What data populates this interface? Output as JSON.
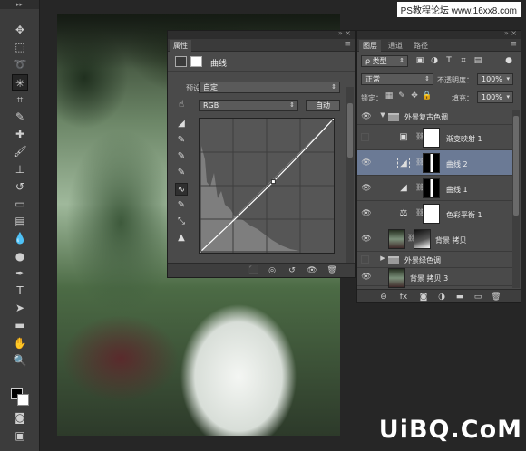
{
  "watermark_top": "PS教程论坛 www.16xx8.com",
  "watermark_bottom": "UiBQ.CoM",
  "toolbar": {
    "tools": [
      {
        "name": "move-tool",
        "glyph": "✥"
      },
      {
        "name": "marquee-tool",
        "glyph": "⬚"
      },
      {
        "name": "lasso-tool",
        "glyph": "➰"
      },
      {
        "name": "magic-wand-tool",
        "glyph": "✳"
      },
      {
        "name": "crop-tool",
        "glyph": "⌗"
      },
      {
        "name": "eyedropper-tool",
        "glyph": "✎"
      },
      {
        "name": "healing-brush-tool",
        "glyph": "✚"
      },
      {
        "name": "brush-tool",
        "glyph": "🖌"
      },
      {
        "name": "clone-stamp-tool",
        "glyph": "⊥"
      },
      {
        "name": "history-brush-tool",
        "glyph": "↺"
      },
      {
        "name": "eraser-tool",
        "glyph": "▭"
      },
      {
        "name": "gradient-tool",
        "glyph": "▤"
      },
      {
        "name": "blur-tool",
        "glyph": "💧"
      },
      {
        "name": "dodge-tool",
        "glyph": "●"
      },
      {
        "name": "pen-tool",
        "glyph": "✒"
      },
      {
        "name": "type-tool",
        "glyph": "T"
      },
      {
        "name": "path-selection-tool",
        "glyph": "➤"
      },
      {
        "name": "shape-tool",
        "glyph": "▬"
      },
      {
        "name": "hand-tool",
        "glyph": "✋"
      },
      {
        "name": "zoom-tool",
        "glyph": "🔍"
      },
      {
        "name": "quick-mask-tool",
        "glyph": "◙"
      },
      {
        "name": "screen-mode-tool",
        "glyph": "▣"
      }
    ]
  },
  "properties": {
    "tab_label": "属性",
    "title": "曲线",
    "preset_label": "预设：",
    "preset_value": "自定",
    "channel_value": "RGB",
    "auto_label": "自动",
    "curve_points": [
      [
        0,
        0
      ],
      [
        0.55,
        0.53
      ],
      [
        1,
        1
      ]
    ],
    "side_tools": [
      "◢",
      "✎",
      "✎",
      "✎",
      "∿",
      "✎",
      "⤡",
      "▲"
    ]
  },
  "layers": {
    "tabs": [
      "图层",
      "通道",
      "路径"
    ],
    "filter_kind": "ρ 类型",
    "blend_mode": "正常",
    "opacity_label": "不透明度：",
    "opacity_value": "100%",
    "lock_label": "锁定：",
    "fill_label": "填充：",
    "fill_value": "100%",
    "rows": [
      {
        "type": "group",
        "name": "外景复古色调",
        "visible": true,
        "expanded": true
      },
      {
        "type": "adjust",
        "icon": "▣",
        "name": "渐变映射 1",
        "visible": false,
        "mask": "white"
      },
      {
        "type": "adjust",
        "icon": "◢",
        "name": "曲线 2",
        "visible": true,
        "mask": "silhouette",
        "selected": true
      },
      {
        "type": "adjust",
        "icon": "◢",
        "name": "曲线 1",
        "visible": true,
        "mask": "silhouette"
      },
      {
        "type": "adjust",
        "icon": "⚖",
        "name": "色彩平衡 1",
        "visible": true,
        "mask": "white"
      },
      {
        "type": "pixel",
        "name": "背景 拷贝",
        "visible": true,
        "mask": "dark"
      },
      {
        "type": "group",
        "name": "外景绿色调",
        "visible": false,
        "expanded": false
      },
      {
        "type": "pixel",
        "name": "背景 拷贝 3",
        "visible": true
      }
    ],
    "footer_icons": [
      "link-icon",
      "fx-icon",
      "mask-icon",
      "adjustment-icon",
      "folder-icon",
      "new-layer-icon",
      "trash-icon"
    ]
  }
}
